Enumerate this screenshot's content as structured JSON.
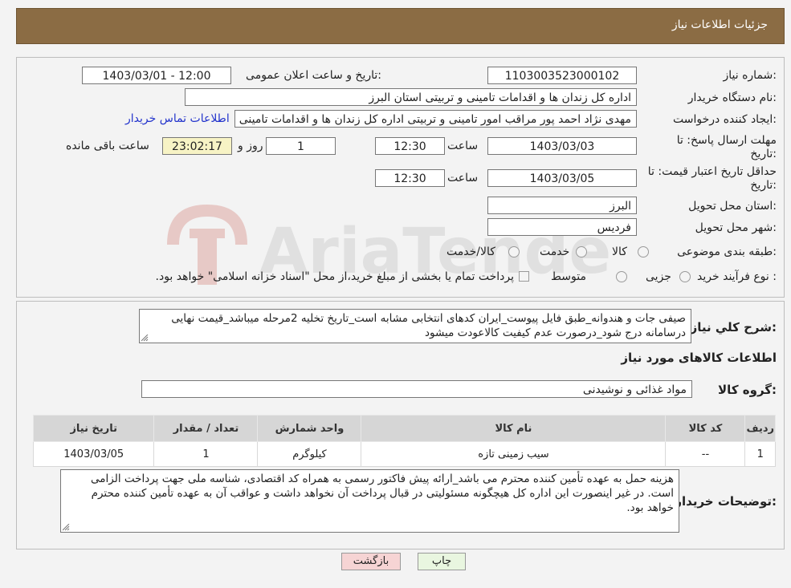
{
  "header": {
    "title": "جزئیات اطلاعات نیاز"
  },
  "form": {
    "need_number_label": "شماره نیاز:",
    "need_number": "1103003523000102",
    "announce_label": "تاریخ و ساعت اعلان عمومی:",
    "announce_value": "1403/03/01 - 12:00",
    "buyer_org_label": "نام دستگاه خریدار:",
    "buyer_org": "اداره کل زندان ها و اقدامات تامینی و تربیتی استان البرز",
    "creator_label": "ایجاد کننده درخواست:",
    "creator": "مهدی نژاد احمد پور مراقب امور تامینی و تربیتی اداره کل زندان ها و اقدامات تامینی",
    "contact_link": "اطلاعات تماس خریدار",
    "reply_deadline_label_1": "مهلت ارسال پاسخ: تا",
    "reply_deadline_label_2": "تاریخ:",
    "reply_date": "1403/03/03",
    "time_label": "ساعت",
    "reply_time": "12:30",
    "days_value": "1",
    "days_label": "روز و",
    "remaining_time": "23:02:17",
    "remaining_label": "ساعت باقی مانده",
    "validity_label_1": "حداقل تاریخ اعتبار قیمت: تا",
    "validity_label_2": "تاریخ:",
    "validity_date": "1403/03/05",
    "validity_time": "12:30",
    "province_label": "استان محل تحویل:",
    "province": "البرز",
    "city_label": "شهر محل تحویل:",
    "city": "فردیس",
    "category_label": "طبقه بندی موضوعی:",
    "category_options": [
      "کالا",
      "خدمت",
      "کالا/خدمت"
    ],
    "process_label": "نوع فرآیند خرید :",
    "process_options": [
      "جزیی",
      "متوسط"
    ],
    "process_note": "پرداخت تمام یا بخشی از مبلغ خرید،از محل \"اسناد خزانه اسلامی\" خواهد بود."
  },
  "description": {
    "label": "شرح کلي نياز:",
    "text": "صیفی جات و هندوانه_طبق فایل پیوست_ایران کدهای انتخابی مشابه است_تاریخ تخلیه 2مرحله میباشد_قیمت نهایی درسامانه درج شود_درصورت عدم کیفیت کالاعودت میشود"
  },
  "goods": {
    "title": "اطلاعات کالاهای مورد نیاز",
    "group_label": "گروه کالا:",
    "group_value": "مواد غذائی و نوشیدنی",
    "columns": [
      "ردیف",
      "کد کالا",
      "نام کالا",
      "واحد شمارش",
      "تعداد / مقدار",
      "تاریخ نیاز"
    ],
    "rows": [
      [
        "1",
        "--",
        "سیب زمینی تازه",
        "کیلوگرم",
        "1",
        "1403/03/05"
      ]
    ]
  },
  "buyer_notes": {
    "label": "توضیحات خریدار:",
    "text": "هزینه حمل به عهده تأمین کننده محترم می باشد_ارائه پیش فاکتور رسمی به همراه کد اقتصادی، شناسه ملی جهت پرداخت الزامی است. در غیر اینصورت این اداره کل هیچگونه مسئولیتی در قبال پرداخت آن نخواهد داشت و عواقب آن به عهده تأمین کننده محترم خواهد بود."
  },
  "buttons": {
    "print": "چاپ",
    "back": "بازگشت"
  },
  "watermark": "AriaTender.neT",
  "colors": {
    "header_bg": "#8b6c44",
    "link": "#2233cc",
    "back_btn_bg": "#f6d4d4"
  }
}
